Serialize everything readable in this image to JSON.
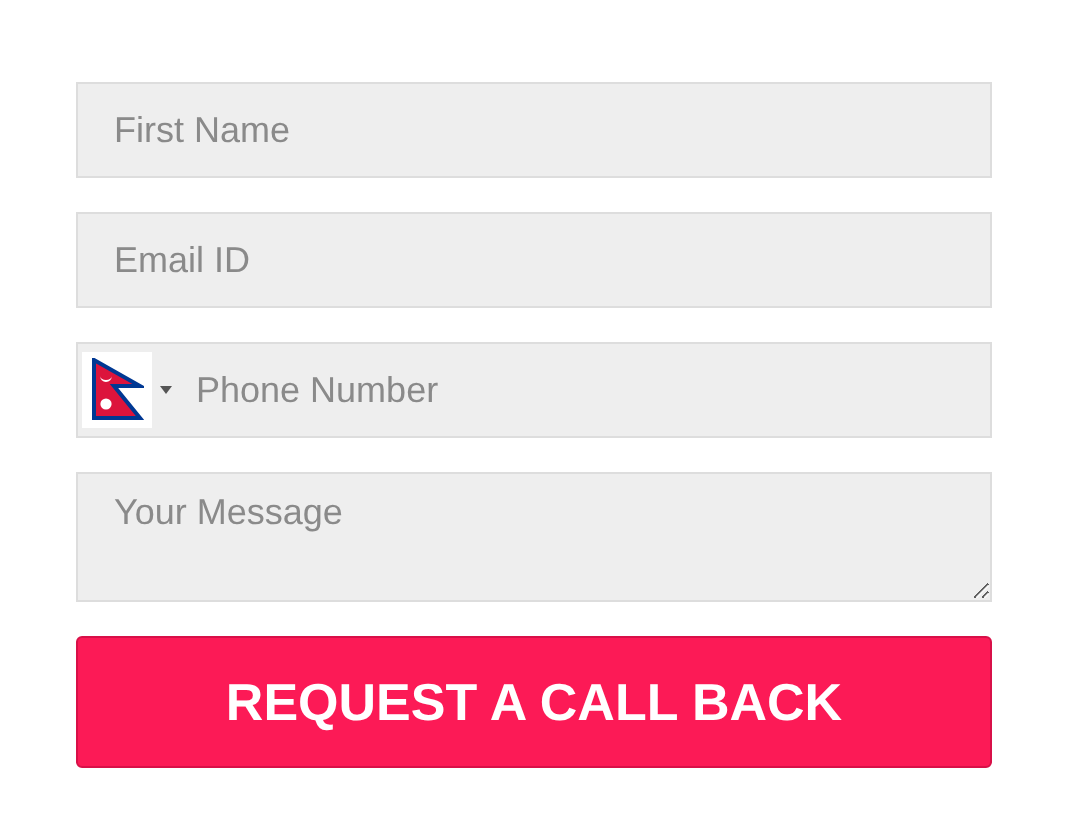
{
  "form": {
    "fields": [
      {
        "kind": "text",
        "placeholder": "First Name"
      },
      {
        "kind": "text",
        "placeholder": "Email ID"
      },
      {
        "kind": "phone",
        "placeholder": "Phone Number"
      },
      {
        "kind": "textarea",
        "placeholder": "Your Message"
      }
    ],
    "submit": "REQUEST A CALL BACK"
  }
}
